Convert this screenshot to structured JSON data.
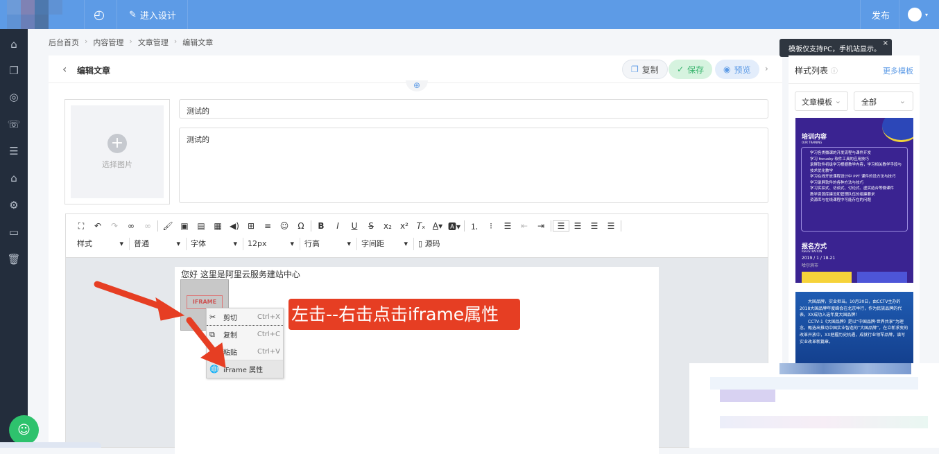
{
  "topbar": {
    "design_label": "进入设计",
    "publish_label": "发布"
  },
  "breadcrumb": [
    "后台首页",
    "内容管理",
    "文章管理",
    "编辑文章"
  ],
  "editor_header": {
    "title": "编辑文章",
    "copy": "复制",
    "save": "保存",
    "preview": "预览"
  },
  "form": {
    "select_image": "选择图片",
    "title_value": "测试的",
    "summary_value": "测试的"
  },
  "toolbar": {
    "selects": [
      "样式",
      "普通",
      "字体",
      "12px",
      "行高",
      "字间距"
    ],
    "source": "源码"
  },
  "content": {
    "text": "您好 这里是阿里云服务建站中心",
    "iframe_label": "IFRAME"
  },
  "context_menu": [
    {
      "label": "剪切",
      "shortcut": "Ctrl+X",
      "icon": "✂"
    },
    {
      "label": "复制",
      "shortcut": "Ctrl+C",
      "icon": "⧉"
    },
    {
      "label": "粘贴",
      "shortcut": "Ctrl+V",
      "icon": "📋"
    },
    {
      "label": "iFrame 属性",
      "shortcut": "",
      "icon": "🌐"
    }
  ],
  "callout": "左击--右击点击iframe属性",
  "right_panel": {
    "tooltip": "模板仅支持PC，手机站显示。",
    "title": "样式列表",
    "more": "更多模板",
    "filter1": "文章模板",
    "filter2": "全部",
    "template1": {
      "heading": "培训内容",
      "sub": "OUR TRAINING",
      "items": [
        "学习各类微课的开发流程与课件开发",
        "学习 focusky 软件工具的应用技巧",
        "录屏软件初级学习根据教学内容，学习相关教学手段与技术优化教学",
        "学习在线开放课程设计中 PPT 课件的设方法与技巧",
        "学习录屏软件的各种方法与技巧",
        "学习实拍式、访谈式、讨论式、虚实结合等微课件",
        "教学资源库建设和管理队伍的组建要求",
        "资源库与在线课程中可能存在的问题"
      ],
      "heading2": "报名方式",
      "sub2": "REGISTRATION",
      "date": "2019 / 1 / 18-21",
      "city": "哈尔滨市"
    },
    "template2": {
      "p1": "大国品牌，实业担当。10月30日，由CCTV主办的2018大国品牌年度峰会在北京举行，作为民族品牌的代表，XX成功入选年度大国品牌！",
      "p2": "CCTV-1《大国品牌》是以“中国品牌·世界共享”为理念，甄选出推动中国实业智造的“大国品牌”，在立新求变的改革开放中，XX把握历史机遇，成就行业领军品牌，谱写实业改革新篇章。"
    }
  },
  "colors": {
    "topbar": "#5d9be6",
    "sidebar": "#232d3c",
    "callout": "#e63e23",
    "save": "#34b36a"
  }
}
